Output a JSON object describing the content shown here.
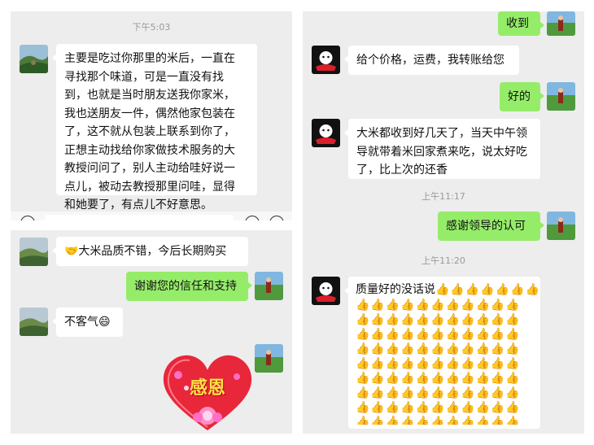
{
  "panel_top_left": {
    "timestamp": "下午5:03",
    "message": "主要是吃过你那里的米后，一直在寻找那个味道，可是一直没有找到，也就是当时朋友送我你家米，我也送朋友一件，偶然他家包装在了，这不就从包装上联系到你了，正想主动找给你家做技术服务的大教授问问了，别人主动给哇好说一点儿，被动去教授那里问哇，显得和她要了，有点儿不好意思。",
    "lines": [
      "主要是吃过你那里的米后，一直在",
      "寻找那个味道，可是一直没有找",
      "到，也就是当时朋友送我你家米，",
      "我也送朋友一件，偶然他家包装在",
      "了，这不就从包装上联系到你了，",
      "正想主动找给你家做技术服务的大",
      "教授问问了，别人主动给哇好说一",
      "点儿，被动去教授那里问哇，显得",
      "和她要了，有点儿不好意思。"
    ]
  },
  "panel_bottom_left": {
    "msg1": "🤝大米品质不错，今后长期购买",
    "msg2": "谢谢您的信任和支持",
    "msg3": "不客气😄",
    "sticker_text": "感恩"
  },
  "panel_right": {
    "msg_recv_label": "收到",
    "msg_price": "给个价格，运费，我转账给您",
    "msg_ok": "好的",
    "msg_review_lines": [
      "大米都收到好几天了，当天中午领",
      "导就带着米回家煮来吃，说太好吃",
      "了，比上次的还香"
    ],
    "ts1": "上午11:17",
    "msg_thanks": "感谢领导的认可",
    "ts2": "上午11:20",
    "msg_quality": "质量好的没话说",
    "thumbs_first_line": "👍👍👍👍👍👍👍",
    "thumbs_body": "👍👍👍👍👍👍👍👍👍👍👍👍👍👍👍👍👍👍👍👍👍👍👍👍👍👍👍👍👍👍👍👍👍👍👍👍👍👍👍👍👍👍👍👍👍👍👍👍👍👍👍👍👍👍👍👍👍👍👍👍👍👍👍👍👍👍👍👍👍👍👍👍👍👍👍👍👍👍👍👍👍👍👍👍👍👍👍👍👍👍👍👍👍👍👍👍👍👍👍👍👍"
  },
  "colors": {
    "chat_bg": "#ededed",
    "bubble_self": "#95ec69",
    "bubble_other": "#ffffff",
    "heart": "#e8273a"
  }
}
